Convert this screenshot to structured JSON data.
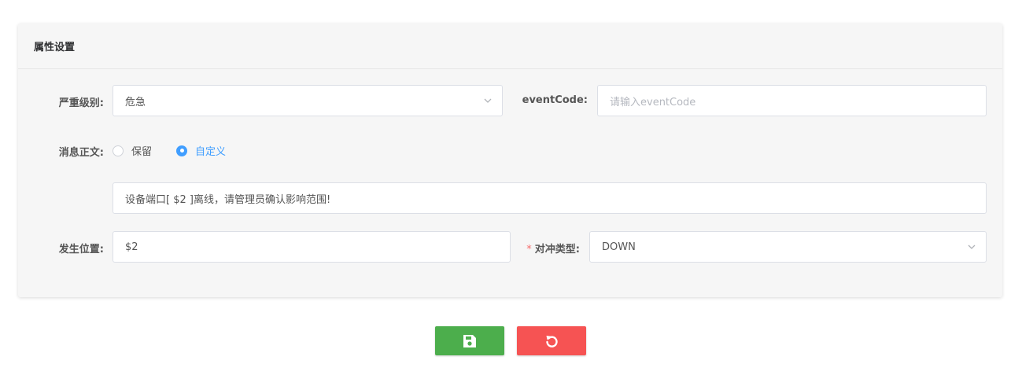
{
  "panel": {
    "title": "属性设置"
  },
  "form": {
    "severity": {
      "label": "严重级别:",
      "value": "危急"
    },
    "event_code": {
      "label": "eventCode:",
      "value": "",
      "placeholder": "请输入eventCode"
    },
    "message_body": {
      "label": "消息正文:",
      "options": [
        {
          "label": "保留",
          "checked": false
        },
        {
          "label": "自定义",
          "checked": true
        }
      ],
      "custom_text": "设备端口[ $2 ]离线，请管理员确认影响范围!"
    },
    "location": {
      "label": "发生位置:",
      "value": "$2"
    },
    "counter_type": {
      "required_mark": "*",
      "label": "对冲类型:",
      "value": "DOWN"
    }
  },
  "actions": {
    "save_icon": "save-icon",
    "reset_icon": "reset-icon"
  },
  "colors": {
    "save": "#4cae4c",
    "reset": "#f65353",
    "accent": "#409eff",
    "required": "#f56c6c"
  }
}
